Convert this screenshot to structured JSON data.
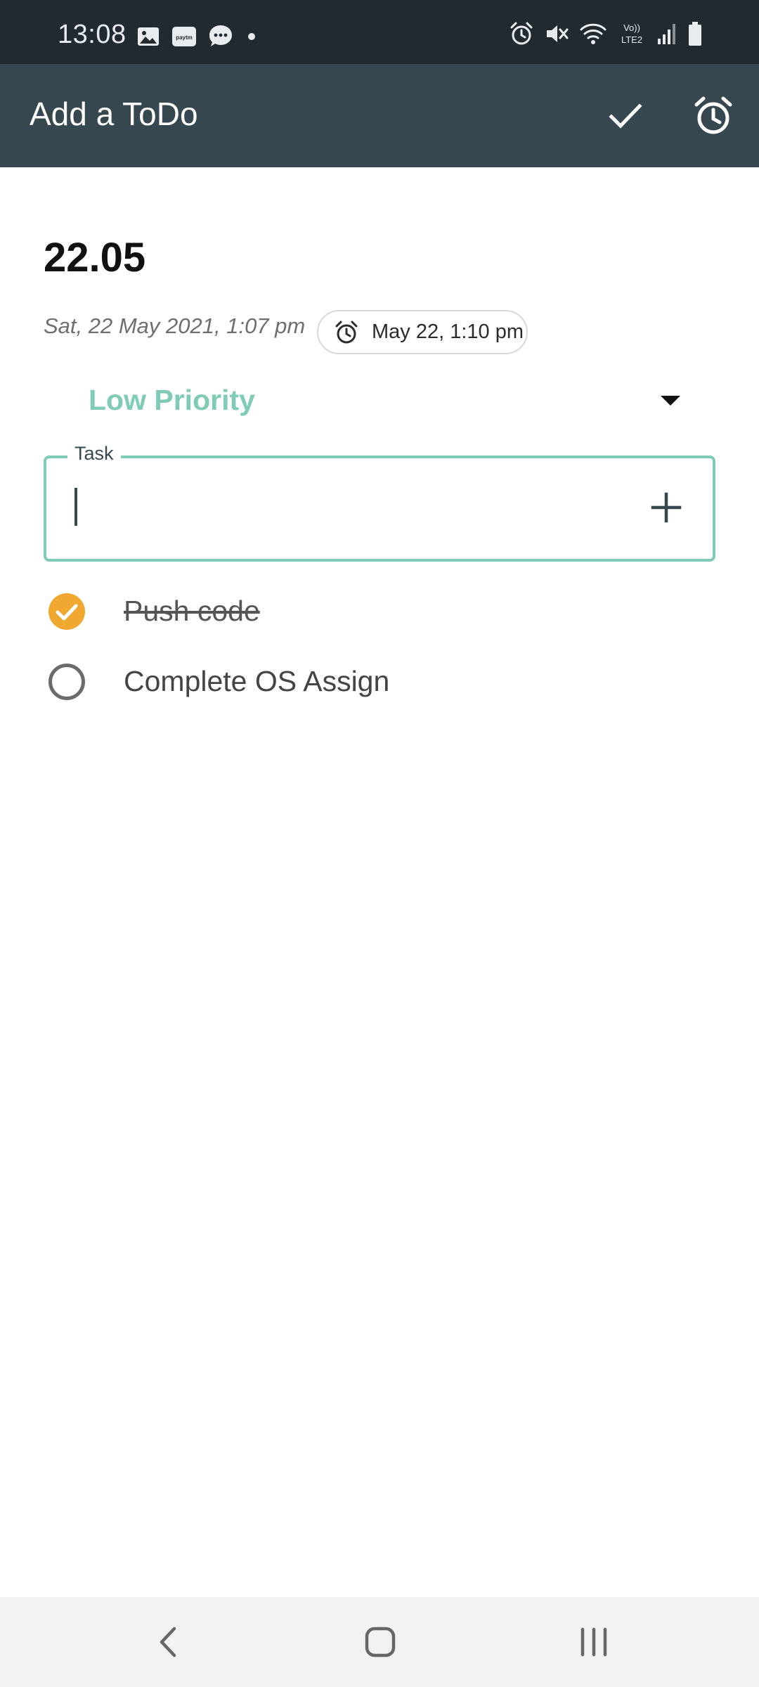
{
  "status_bar": {
    "time": "13:08",
    "left_icons": [
      "gallery-icon",
      "paytm-icon",
      "messages-icon",
      "dot-icon"
    ],
    "right_icons": [
      "alarm-icon",
      "mute-icon",
      "wifi-icon",
      "volte-icon",
      "signal-icon",
      "battery-icon"
    ],
    "volte_line1": "Vo))",
    "volte_line2": "LTE2",
    "paytm_text": "paytm"
  },
  "app_bar": {
    "title": "Add a ToDo",
    "actions": [
      "check-icon",
      "alarm-icon"
    ]
  },
  "note": {
    "title": "22.05",
    "created": "Sat, 22 May 2021, 1:07 pm",
    "reminder": "May 22, 1:10 pm",
    "priority": "Low Priority"
  },
  "task_field": {
    "label": "Task",
    "value": "",
    "placeholder": ""
  },
  "todos": [
    {
      "text": "Push code",
      "done": true
    },
    {
      "text": "Complete OS Assign",
      "done": false
    }
  ],
  "colors": {
    "status_bar": "#212a31",
    "app_bar": "#37474f",
    "accent": "#7fcbb7",
    "checked": "#f0a830",
    "nav_bar": "#f2f2f2"
  },
  "nav_bar": {
    "buttons": [
      "back-icon",
      "home-icon",
      "recents-icon"
    ]
  }
}
